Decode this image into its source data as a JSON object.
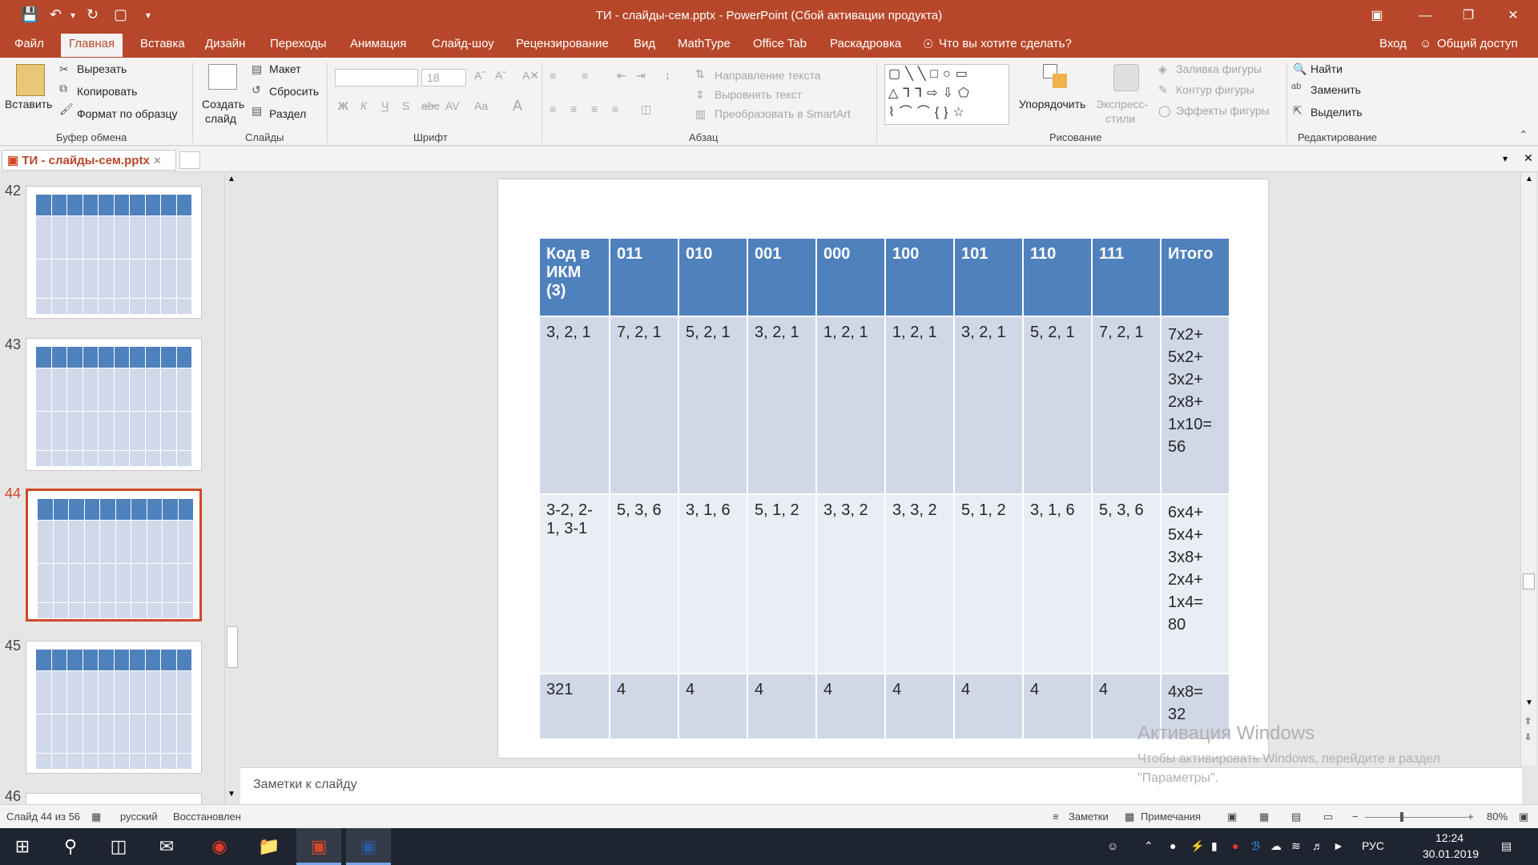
{
  "window": {
    "title": "ТИ - слайды-сем.pptx - PowerPoint (Сбой активации продукта)"
  },
  "menu_tabs": [
    "Файл",
    "Главная",
    "Вставка",
    "Дизайн",
    "Переходы",
    "Анимация",
    "Слайд-шоу",
    "Рецензирование",
    "Вид",
    "MathType",
    "Office Tab",
    "Раскадровка"
  ],
  "menu": {
    "search": "Что вы хотите сделать?",
    "signin": "Вход",
    "share": "Общий доступ"
  },
  "ribbon": {
    "clipboard": {
      "paste": "Вставить",
      "cut": "Вырезать",
      "copy": "Копировать",
      "format_painter": "Формат по образцу",
      "group": "Буфер обмена"
    },
    "slides": {
      "new_slide": "Создать",
      "new_slide2": "слайд",
      "layout": "Макет",
      "reset": "Сбросить",
      "section": "Раздел",
      "group": "Слайды"
    },
    "font": {
      "size": "18",
      "group": "Шрифт"
    },
    "paragraph": {
      "text_direction": "Направление текста",
      "align_text": "Выровнять текст",
      "smartart": "Преобразовать в SmartArt",
      "group": "Абзац"
    },
    "drawing": {
      "arrange": "Упорядочить",
      "quick_styles": "Экспресс-",
      "quick_styles2": "стили",
      "fill": "Заливка фигуры",
      "outline": "Контур фигуры",
      "effects": "Эффекты фигуры",
      "group": "Рисование"
    },
    "editing": {
      "find": "Найти",
      "replace": "Заменить",
      "select": "Выделить",
      "group": "Редактирование"
    }
  },
  "doc_tab": "ТИ - слайды-сем.pptx",
  "thumbnails": [
    {
      "num": "42"
    },
    {
      "num": "43"
    },
    {
      "num": "44"
    },
    {
      "num": "45"
    },
    {
      "num": "46"
    }
  ],
  "slide_table": {
    "headers": [
      "Код в ИКМ (3)",
      "011",
      "010",
      "001",
      "000",
      "100",
      "101",
      "110",
      "111",
      "Итого"
    ],
    "rows": [
      [
        "3, 2, 1",
        "7, 2, 1",
        "5, 2, 1",
        "3, 2, 1",
        "1, 2, 1",
        "1, 2, 1",
        "3, 2, 1",
        "5, 2, 1",
        "7, 2, 1",
        "7x2+ 5x2+ 3x2+ 2x8+ 1x10= 56"
      ],
      [
        "3-2, 2-1, 3-1",
        "5, 3, 6",
        "3, 1, 6",
        "5, 1, 2",
        "3, 3, 2",
        "3, 3, 2",
        "5, 1, 2",
        "3, 1, 6",
        "5, 3, 6",
        "6x4+ 5x4+ 3x8+ 2x4+ 1x4= 80"
      ],
      [
        "321",
        "4",
        "4",
        "4",
        "4",
        "4",
        "4",
        "4",
        "4",
        "4x8= 32"
      ]
    ]
  },
  "notes_placeholder": "Заметки к слайду",
  "watermark": {
    "title": "Активация Windows",
    "line1": "Чтобы активировать Windows, перейдите в раздел",
    "line2": "\"Параметры\"."
  },
  "status": {
    "slide": "Слайд 44 из 56",
    "language": "русский",
    "state": "Восстановлен",
    "notes": "Заметки",
    "comments": "Примечания",
    "zoom": "80%"
  },
  "taskbar": {
    "lang": "РУС",
    "time": "12:24",
    "date": "30.01.2019"
  }
}
